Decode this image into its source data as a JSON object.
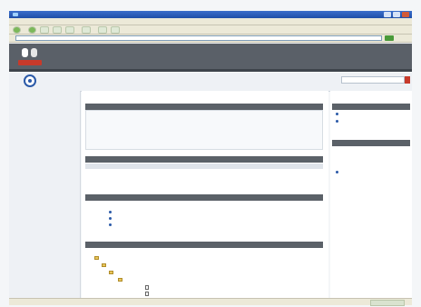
{
  "browser": {
    "title": "",
    "menu": [
      "",
      "",
      "",
      "",
      "",
      ""
    ],
    "toolbar_labels": [
      "",
      "",
      ""
    ],
    "address_label": "",
    "address_value": ""
  },
  "header": {
    "logo_text": "",
    "nav": [
      "",
      "",
      "",
      "",
      ""
    ],
    "right_link": ""
  },
  "page": {
    "title": "",
    "subtitle": ""
  },
  "sidebar": {
    "items": [
      "",
      ""
    ]
  },
  "main": {
    "breadcrumb": "",
    "panels": [
      {
        "header": "",
        "title": "",
        "date": "",
        "text": "",
        "link": ""
      },
      {
        "header": ""
      },
      {
        "header": ""
      },
      {
        "header": ""
      }
    ],
    "table": {
      "columns": [
        "",
        "",
        "",
        ""
      ],
      "rows": [
        [
          "",
          "",
          "",
          ""
        ]
      ]
    },
    "list": [
      "",
      "",
      ""
    ],
    "tree": [
      "",
      "",
      "",
      "",
      "",
      ""
    ]
  },
  "right_sidebar": {
    "sections": [
      {
        "header": "",
        "items": [
          "",
          ""
        ]
      },
      {
        "header": "",
        "items": [
          "",
          "",
          "",
          ""
        ]
      }
    ]
  },
  "status": {
    "text": "",
    "zone": ""
  },
  "colors": {
    "accent_red": "#c73a2b",
    "header_gray": "#5a6068",
    "link_blue": "#2b5aa8"
  }
}
